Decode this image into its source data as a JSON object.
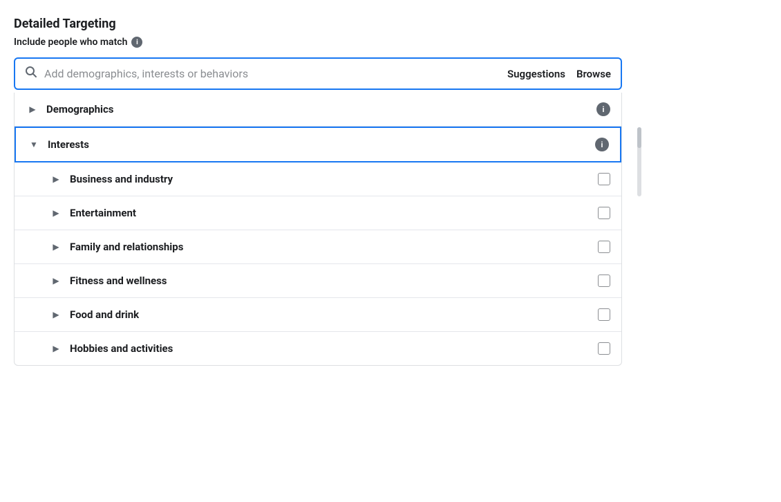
{
  "page": {
    "title": "Detailed Targeting",
    "subtitle": "Include people who match",
    "search": {
      "placeholder": "Add demographics, interests or behaviors",
      "suggestions_label": "Suggestions",
      "browse_label": "Browse"
    },
    "categories": [
      {
        "id": "demographics",
        "label": "Demographics",
        "expanded": false,
        "has_info": true,
        "is_sub": false,
        "chevron": "▶"
      },
      {
        "id": "interests",
        "label": "Interests",
        "expanded": true,
        "has_info": true,
        "is_sub": false,
        "highlighted": true,
        "chevron": "▼"
      },
      {
        "id": "business-and-industry",
        "label": "Business and industry",
        "expanded": false,
        "has_checkbox": true,
        "is_sub": true,
        "chevron": "▶"
      },
      {
        "id": "entertainment",
        "label": "Entertainment",
        "expanded": false,
        "has_checkbox": true,
        "is_sub": true,
        "chevron": "▶"
      },
      {
        "id": "family-and-relationships",
        "label": "Family and relationships",
        "expanded": false,
        "has_checkbox": true,
        "is_sub": true,
        "chevron": "▶"
      },
      {
        "id": "fitness-and-wellness",
        "label": "Fitness and wellness",
        "expanded": false,
        "has_checkbox": true,
        "is_sub": true,
        "chevron": "▶"
      },
      {
        "id": "food-and-drink",
        "label": "Food and drink",
        "expanded": false,
        "has_checkbox": true,
        "is_sub": true,
        "chevron": "▶"
      },
      {
        "id": "hobbies-and-activities",
        "label": "Hobbies and activities",
        "expanded": false,
        "has_checkbox": true,
        "is_sub": true,
        "chevron": "▶"
      }
    ]
  }
}
